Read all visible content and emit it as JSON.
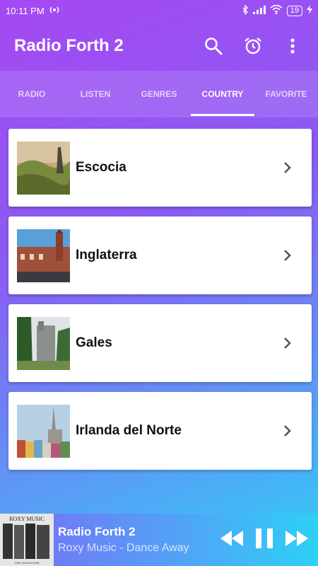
{
  "status": {
    "time": "10:11 PM",
    "battery": "19"
  },
  "appbar": {
    "title": "Radio Forth 2"
  },
  "tabs": [
    {
      "label": "RADIO"
    },
    {
      "label": "LISTEN"
    },
    {
      "label": "GENRES"
    },
    {
      "label": "COUNTRY"
    },
    {
      "label": "FAVORITE"
    }
  ],
  "countries": [
    {
      "label": "Escocia"
    },
    {
      "label": "Inglaterra"
    },
    {
      "label": "Gales"
    },
    {
      "label": "Irlanda del Norte"
    }
  ],
  "player": {
    "title": "Radio Forth 2",
    "subtitle": "Roxy Music - Dance Away",
    "album_text": "ROXY MUSIC",
    "album_sub": "THE COLLECTION"
  }
}
